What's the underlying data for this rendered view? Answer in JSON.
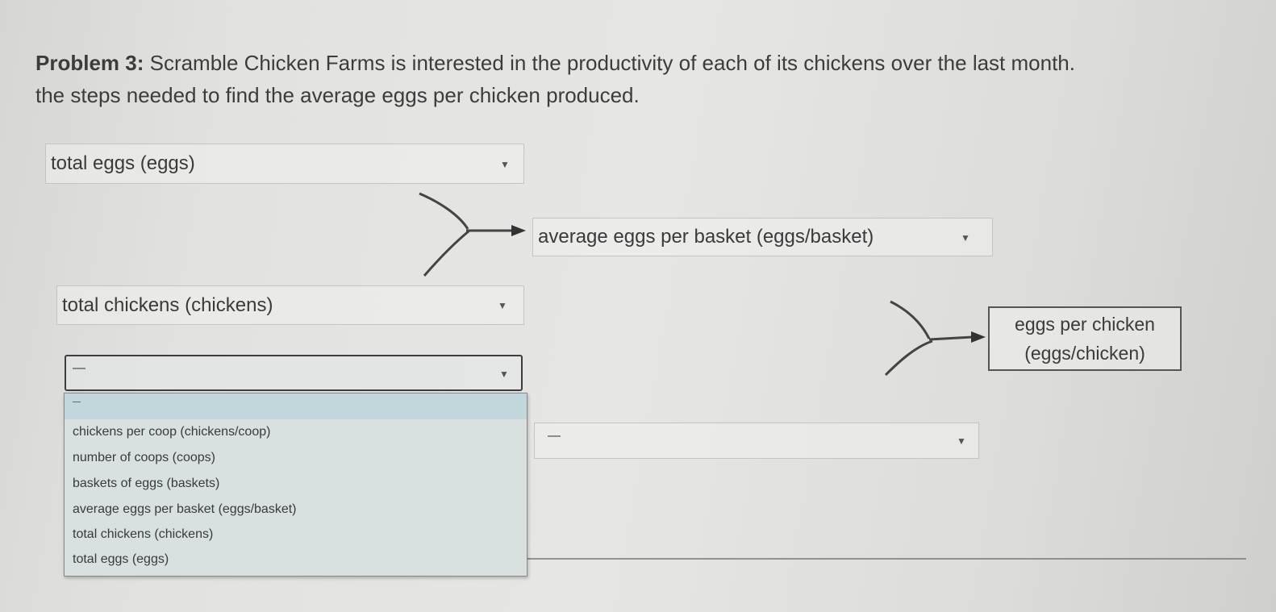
{
  "problem": {
    "label": "Problem 3:",
    "line1": " Scramble Chicken Farms is interested in the productivity of each of its chickens over the last month.",
    "line2": "the steps needed to find the average eggs per chicken produced."
  },
  "steps": {
    "select_total_eggs": "total eggs (eggs)",
    "select_average_eggs_per_basket": "average eggs per basket (eggs/basket)",
    "select_total_chickens": "total chickens (chickens)",
    "select_open": "—",
    "select_empty_right": "—",
    "result_line1": "eggs per chicken",
    "result_line2": "(eggs/chicken)"
  },
  "dropdown": {
    "placeholder": "—",
    "options": [
      "chickens per coop (chickens/coop)",
      "number of coops (coops)",
      "baskets of eggs (baskets)",
      "average eggs per basket (eggs/basket)",
      "total chickens (chickens)",
      "total eggs (eggs)"
    ]
  },
  "icons": {
    "caret": "caret-down-icon",
    "arrow": "arrow-right-icon"
  },
  "colors": {
    "dropdown_bg": "#d9e0e0",
    "dropdown_highlight": "#c2d7dc",
    "text": "#3a3a3a"
  }
}
